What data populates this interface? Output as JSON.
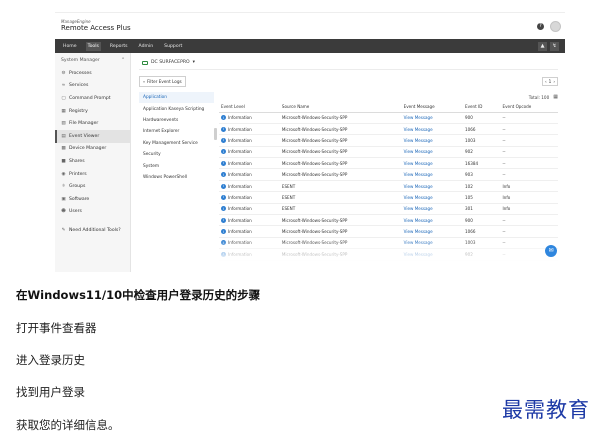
{
  "app": {
    "brand_small": "ManageEngine",
    "brand_main": "Remote Access Plus"
  },
  "nav": {
    "items": [
      "Home",
      "Tools",
      "Reports",
      "Admin",
      "Support"
    ],
    "active": "Tools"
  },
  "sidebar": {
    "header": "System Manager",
    "items": [
      {
        "label": "Processes",
        "icon": "processes-icon"
      },
      {
        "label": "Services",
        "icon": "services-icon"
      },
      {
        "label": "Command Prompt",
        "icon": "command-prompt-icon"
      },
      {
        "label": "Registry",
        "icon": "registry-icon"
      },
      {
        "label": "File Manager",
        "icon": "file-manager-icon"
      },
      {
        "label": "Event Viewer",
        "icon": "event-viewer-icon",
        "active": true
      },
      {
        "label": "Device Manager",
        "icon": "device-manager-icon"
      },
      {
        "label": "Shares",
        "icon": "shares-icon"
      },
      {
        "label": "Printers",
        "icon": "printers-icon"
      },
      {
        "label": "Groups",
        "icon": "groups-icon"
      },
      {
        "label": "Software",
        "icon": "software-icon"
      },
      {
        "label": "Users",
        "icon": "users-icon"
      }
    ],
    "extra": "Need Additional Tools?"
  },
  "device": {
    "name": "DC SURFACEPRO"
  },
  "toolbar": {
    "filter_label": "Filter Event Logs",
    "page": "1"
  },
  "log_types": [
    "Application",
    "Application Kaseya Scripting",
    "Hardwareevents",
    "Internet Explorer",
    "Key Management Service",
    "Security",
    "System",
    "Windows PowerShell"
  ],
  "active_log_type": "Application",
  "total": "Total: 100",
  "table": {
    "columns": [
      "Event Level",
      "Source Name",
      "Event Message",
      "Event ID",
      "Event Opcode"
    ],
    "rows": [
      [
        "Information",
        "Microsoft-Windows-Security-SPP",
        "View Message",
        "900",
        "--"
      ],
      [
        "Information",
        "Microsoft-Windows-Security-SPP",
        "View Message",
        "1066",
        "--"
      ],
      [
        "Information",
        "Microsoft-Windows-Security-SPP",
        "View Message",
        "1003",
        "--"
      ],
      [
        "Information",
        "Microsoft-Windows-Security-SPP",
        "View Message",
        "902",
        "--"
      ],
      [
        "Information",
        "Microsoft-Windows-Security-SPP",
        "View Message",
        "16384",
        "--"
      ],
      [
        "Information",
        "Microsoft-Windows-Security-SPP",
        "View Message",
        "903",
        "--"
      ],
      [
        "Information",
        "ESENT",
        "View Message",
        "102",
        "Info"
      ],
      [
        "Information",
        "ESENT",
        "View Message",
        "105",
        "Info"
      ],
      [
        "Information",
        "ESENT",
        "View Message",
        "301",
        "Info"
      ],
      [
        "Information",
        "Microsoft-Windows-Security-SPP",
        "View Message",
        "900",
        "--"
      ],
      [
        "Information",
        "Microsoft-Windows-Security-SPP",
        "View Message",
        "1066",
        "--"
      ],
      [
        "Information",
        "Microsoft-Windows-Security-SPP",
        "View Message",
        "1003",
        "--"
      ],
      [
        "Information",
        "Microsoft-Windows-Security-SPP",
        "View Message",
        "902",
        "--"
      ]
    ]
  },
  "article": {
    "heading": "在Windows11/10中检查用户登录历史的步骤",
    "steps": [
      "打开事件查看器",
      "进入登录历史",
      "找到用户登录",
      "获取您的详细信息。"
    ]
  },
  "watermark": "最需教育",
  "colors": {
    "accent": "#1a66b8",
    "nav_bg": "#3b3b3b",
    "watermark": "#1e3aa6",
    "info": "#2f7fd1"
  }
}
